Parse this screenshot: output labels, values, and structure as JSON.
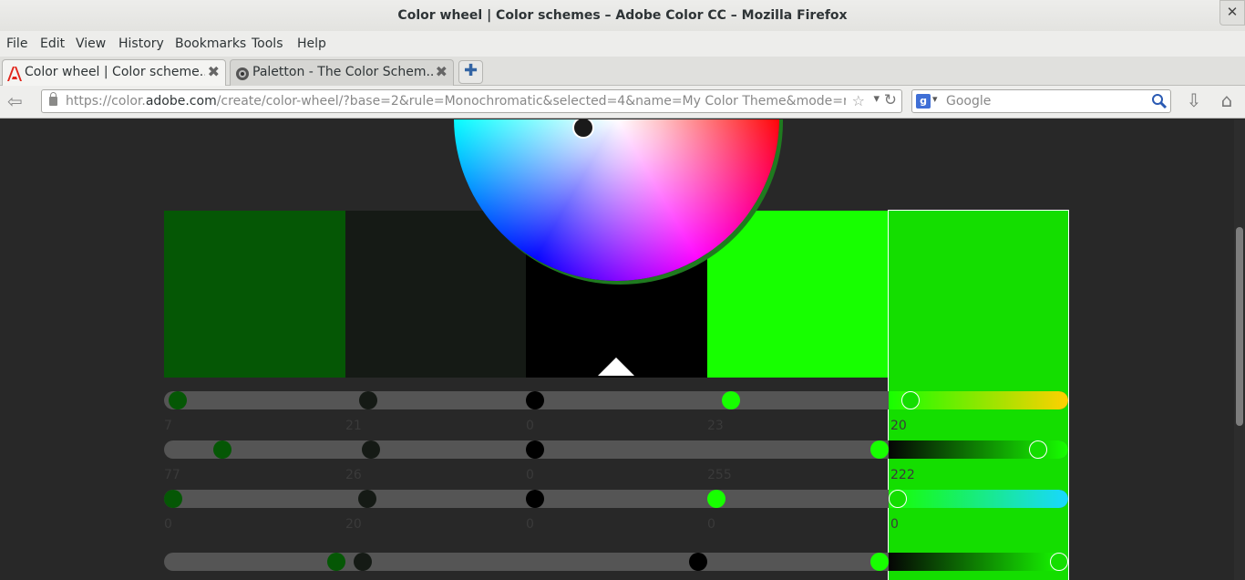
{
  "window": {
    "title": "Color wheel | Color schemes – Adobe Color CC – Mozilla Firefox",
    "close_glyph": "✕"
  },
  "menu": [
    "File",
    "Edit",
    "View",
    "History",
    "Bookmarks",
    "Tools",
    "Help"
  ],
  "tabs": [
    {
      "label": "Color wheel | Color scheme...",
      "icon": "adobe-icon",
      "active": true
    },
    {
      "label": "Paletton - The Color Schem...",
      "icon": "paletton-icon",
      "active": false
    }
  ],
  "tab_close_glyph": "✖",
  "new_tab_glyph": "✚",
  "nav": {
    "url_prefix": "https://color.",
    "url_domain": "adobe.com",
    "url_suffix": "/create/color-wheel/?base=2&rule=Monochromatic&selected=4&name=My Color Theme&mode=rgb&rgt",
    "search_placeholder": "Google"
  },
  "colors": {
    "swatches": [
      "#055705",
      "#151a15",
      "#000000",
      "#17ff00",
      "#14de00"
    ],
    "accent_green": "#17ff00",
    "page_bg": "#282828"
  },
  "sliders": [
    {
      "channel": "hue",
      "values": [
        "7",
        "21",
        "0",
        "23",
        "20"
      ]
    },
    {
      "channel": "r-or-saturation",
      "values": [
        "77",
        "26",
        "0",
        "255",
        "222"
      ]
    },
    {
      "channel": "g-or-brightness",
      "values": [
        "0",
        "20",
        "0",
        "0",
        "0"
      ]
    },
    {
      "channel": "b",
      "values": []
    }
  ]
}
